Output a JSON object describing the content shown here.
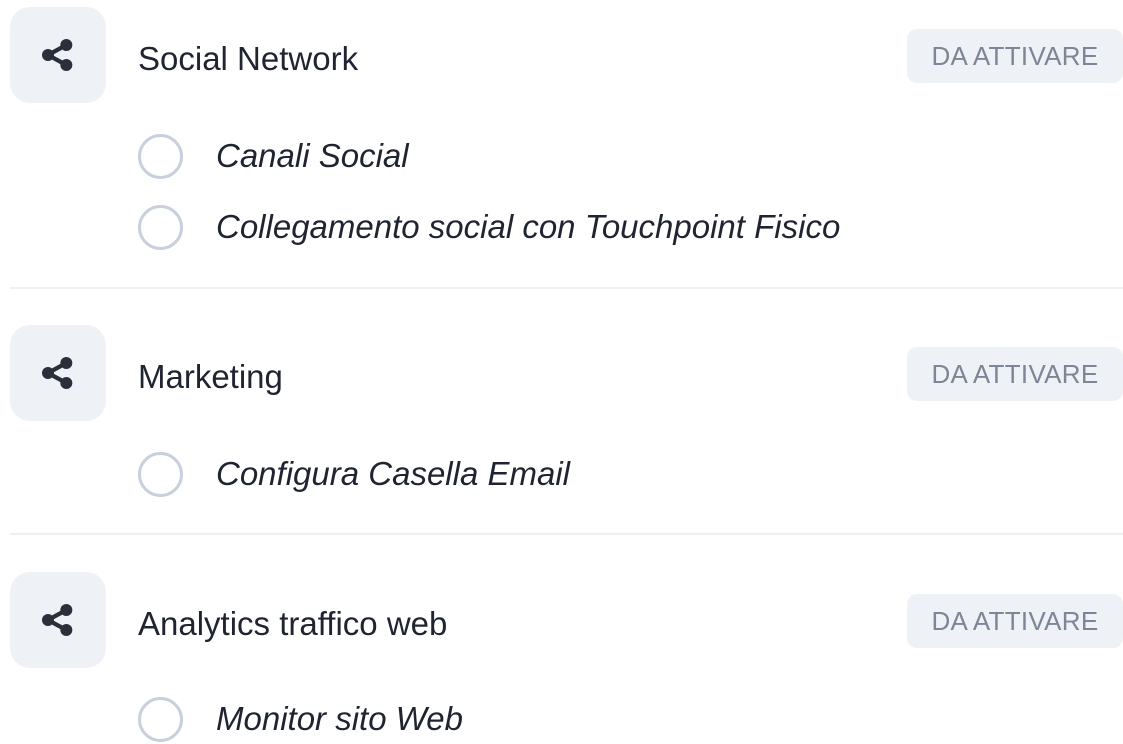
{
  "sections": [
    {
      "title": "Social Network",
      "icon": "share-icon",
      "status": "DA ATTIVARE",
      "tasks": [
        {
          "label": "Canali Social",
          "checked": false
        },
        {
          "label": "Collegamento social con Touchpoint Fisico",
          "checked": false
        }
      ]
    },
    {
      "title": "Marketing",
      "icon": "share-icon",
      "status": "DA ATTIVARE",
      "tasks": [
        {
          "label": "Configura Casella Email",
          "checked": false
        }
      ]
    },
    {
      "title": "Analytics traffico web",
      "icon": "share-icon",
      "status": "DA ATTIVARE",
      "tasks": [
        {
          "label": "Monitor sito Web",
          "checked": false
        }
      ]
    }
  ],
  "colors": {
    "icon": "#2b2f3a",
    "badge_background": "#eef2f7",
    "badge_text": "#7d8696",
    "checkbox_border": "#c8d0dd"
  }
}
